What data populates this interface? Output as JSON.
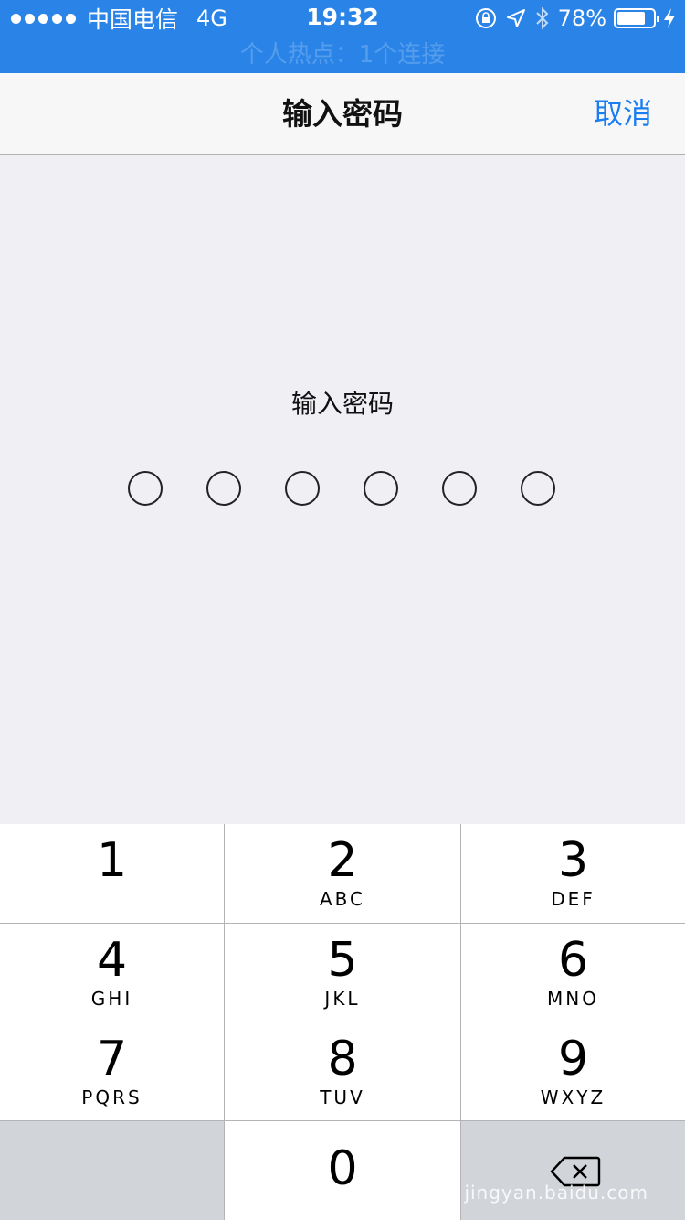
{
  "status_bar": {
    "carrier": "中国电信",
    "network": "4G",
    "time": "19:32",
    "battery_percent": "78%",
    "battery_level": 0.78,
    "hotspot_text": "个人热点：1个连接",
    "icons": [
      "signal-dots-icon",
      "orientation-lock-icon",
      "location-arrow-icon",
      "bluetooth-icon",
      "battery-icon",
      "charging-bolt-icon"
    ]
  },
  "nav": {
    "title": "输入密码",
    "cancel_label": "取消"
  },
  "prompt": "输入密码",
  "passcode_length": 6,
  "keypad": {
    "keys": [
      {
        "num": "1",
        "letters": ""
      },
      {
        "num": "2",
        "letters": "ABC"
      },
      {
        "num": "3",
        "letters": "DEF"
      },
      {
        "num": "4",
        "letters": "GHI"
      },
      {
        "num": "5",
        "letters": "JKL"
      },
      {
        "num": "6",
        "letters": "MNO"
      },
      {
        "num": "7",
        "letters": "PQRS"
      },
      {
        "num": "8",
        "letters": "TUV"
      },
      {
        "num": "9",
        "letters": "WXYZ"
      },
      {
        "num": "0",
        "letters": ""
      }
    ],
    "delete_icon": "backspace-icon"
  },
  "watermark": "jingyan.baidu.com",
  "colors": {
    "status_bar_bg": "#2a84e8",
    "accent": "#1a7ef0",
    "background": "#efeff4"
  }
}
